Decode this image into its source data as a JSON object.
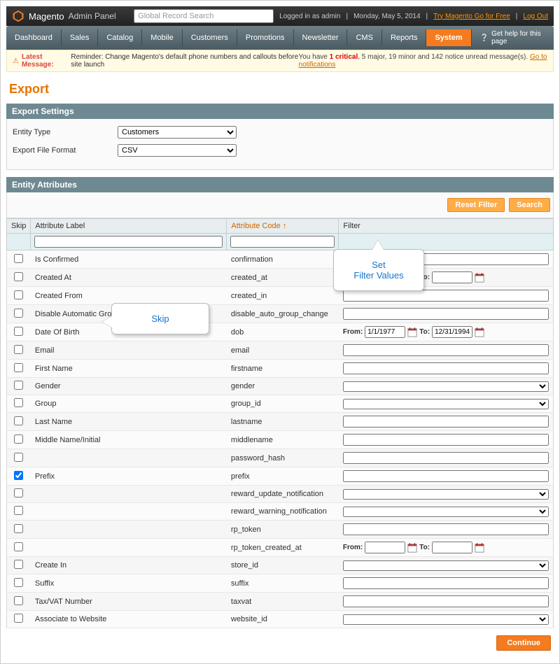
{
  "header": {
    "brand": "Magento",
    "subtitle": "Admin Panel",
    "search_placeholder": "Global Record Search",
    "logged_in": "Logged in as admin",
    "date": "Monday, May 5, 2014",
    "try_link": "Try Magento Go for Free",
    "logout": "Log Out"
  },
  "nav": {
    "items": [
      "Dashboard",
      "Sales",
      "Catalog",
      "Mobile",
      "Customers",
      "Promotions",
      "Newsletter",
      "CMS",
      "Reports",
      "System"
    ],
    "help": "Get help for this page"
  },
  "msg": {
    "label": "Latest Message:",
    "text": "Reminder: Change Magento's default phone numbers and callouts before site launch",
    "right_pre": "You have ",
    "crit": "1 critical",
    "rest": ", 5 major, 19 minor and 142 notice unread message(s). ",
    "link": "Go to notifications"
  },
  "page": {
    "title": "Export"
  },
  "sections": {
    "settings": "Export Settings",
    "attrs": "Entity Attributes"
  },
  "settings": {
    "entity_label": "Entity Type",
    "entity_value": "Customers",
    "format_label": "Export File Format",
    "format_value": "CSV"
  },
  "buttons": {
    "reset": "Reset Filter",
    "search": "Search",
    "continue": "Continue"
  },
  "grid": {
    "headers": {
      "skip": "Skip",
      "label": "Attribute Label",
      "code": "Attribute Code",
      "filter": "Filter"
    },
    "rows": [
      {
        "label": "Is Confirmed",
        "code": "confirmation",
        "filter": "text"
      },
      {
        "label": "Created At",
        "code": "created_at",
        "filter": "date",
        "from": "",
        "to": ""
      },
      {
        "label": "Created From",
        "code": "created_in",
        "filter": "text"
      },
      {
        "label": "Disable Automatic Group Change Based on VAT ID",
        "code": "disable_auto_group_change",
        "filter": "text"
      },
      {
        "label": "Date Of Birth",
        "code": "dob",
        "filter": "date",
        "from": "1/1/1977",
        "to": "12/31/1994"
      },
      {
        "label": "Email",
        "code": "email",
        "filter": "text"
      },
      {
        "label": "First Name",
        "code": "firstname",
        "filter": "text"
      },
      {
        "label": "Gender",
        "code": "gender",
        "filter": "select"
      },
      {
        "label": "Group",
        "code": "group_id",
        "filter": "select"
      },
      {
        "label": "Last Name",
        "code": "lastname",
        "filter": "text"
      },
      {
        "label": "Middle Name/Initial",
        "code": "middlename",
        "filter": "text"
      },
      {
        "label": "",
        "code": "password_hash",
        "filter": "text"
      },
      {
        "label": "Prefix",
        "code": "prefix",
        "filter": "text",
        "skip": true
      },
      {
        "label": "",
        "code": "reward_update_notification",
        "filter": "select"
      },
      {
        "label": "",
        "code": "reward_warning_notification",
        "filter": "select"
      },
      {
        "label": "",
        "code": "rp_token",
        "filter": "text"
      },
      {
        "label": "",
        "code": "rp_token_created_at",
        "filter": "date",
        "from": "",
        "to": ""
      },
      {
        "label": "Create In",
        "code": "store_id",
        "filter": "select"
      },
      {
        "label": "Suffix",
        "code": "suffix",
        "filter": "text"
      },
      {
        "label": "Tax/VAT Number",
        "code": "taxvat",
        "filter": "text"
      },
      {
        "label": "Associate to Website",
        "code": "website_id",
        "filter": "select"
      }
    ]
  },
  "date_labels": {
    "from": "From:",
    "to": "To:"
  },
  "callouts": {
    "skip": "Skip",
    "filter_l1": "Set",
    "filter_l2": "Filter Values"
  }
}
